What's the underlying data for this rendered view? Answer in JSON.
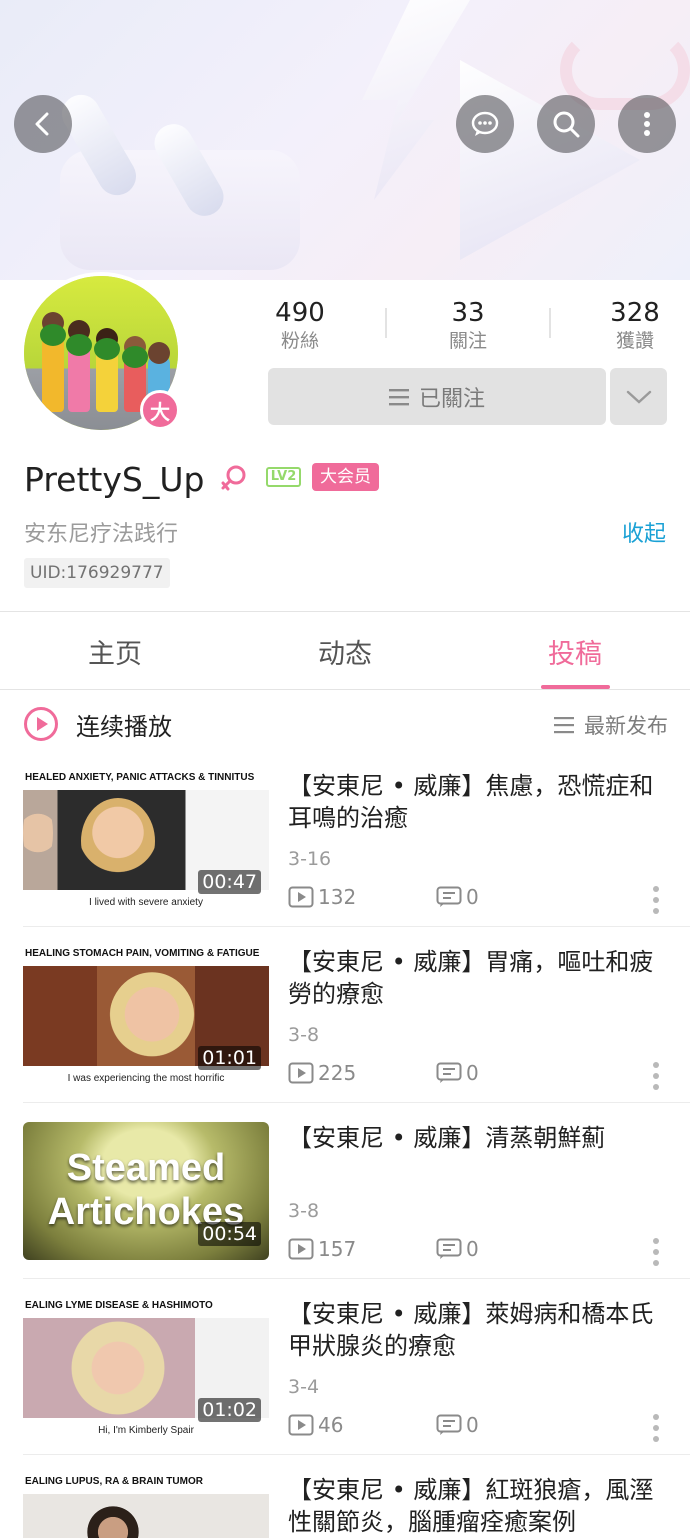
{
  "header": {
    "back_icon": "chevron-left-icon",
    "message_icon": "chat-bubble-icon",
    "search_icon": "search-icon",
    "more_icon": "vertical-dots-icon"
  },
  "profile": {
    "stats": [
      {
        "value": "490",
        "label": "粉絲"
      },
      {
        "value": "33",
        "label": "關注"
      },
      {
        "value": "328",
        "label": "獲讚"
      }
    ],
    "follow_label": "已關注",
    "avatar_badge": "大",
    "name": "PrettyS_Up",
    "level": "LV2",
    "vip_tag": "大会员",
    "bio": "安东尼疗法践行",
    "collapse_label": "收起",
    "uid": "UID:176929777"
  },
  "tabs": [
    {
      "label": "主页",
      "active": false
    },
    {
      "label": "动态",
      "active": false
    },
    {
      "label": "投稿",
      "active": true
    }
  ],
  "playlist": {
    "play_label": "连续播放",
    "sort_label": "最新发布"
  },
  "videos": [
    {
      "title": "【安東尼 • 威廉】焦慮，恐慌症和耳鳴的治癒",
      "date": "3-16",
      "plays": "132",
      "comments": "0",
      "duration": "00:47",
      "thumb_top": "HEALED ANXIETY, PANIC ATTACKS & TINNITUS",
      "thumb_bottom": "I lived with severe anxiety"
    },
    {
      "title": "【安東尼 • 威廉】胃痛，嘔吐和疲勞的療愈",
      "date": "3-8",
      "plays": "225",
      "comments": "0",
      "duration": "01:01",
      "thumb_top": "HEALING STOMACH PAIN, VOMITING & FATIGUE",
      "thumb_bottom": "I was experiencing the most horrific"
    },
    {
      "title": "【安東尼 • 威廉】清蒸朝鮮薊",
      "date": "3-8",
      "plays": "157",
      "comments": "0",
      "duration": "00:54",
      "thumb_big": [
        "Steamed",
        "Artichokes"
      ]
    },
    {
      "title": "【安東尼 • 威廉】萊姆病和橋本氏甲狀腺炎的療愈",
      "date": "3-4",
      "plays": "46",
      "comments": "0",
      "duration": "01:02",
      "thumb_top": "EALING LYME DISEASE & HASHIMOTO",
      "thumb_bottom": "Hi, I'm Kimberly Spair"
    },
    {
      "title": "【安東尼 • 威廉】紅斑狼瘡，風溼性關節炎，腦腫瘤痊癒案例",
      "thumb_top": "EALING LUPUS, RA & BRAIN TUMOR"
    }
  ],
  "colors": {
    "accent_pink": "#f06b9a",
    "link_blue": "#1aa1d5",
    "level_green": "#95d96b"
  }
}
